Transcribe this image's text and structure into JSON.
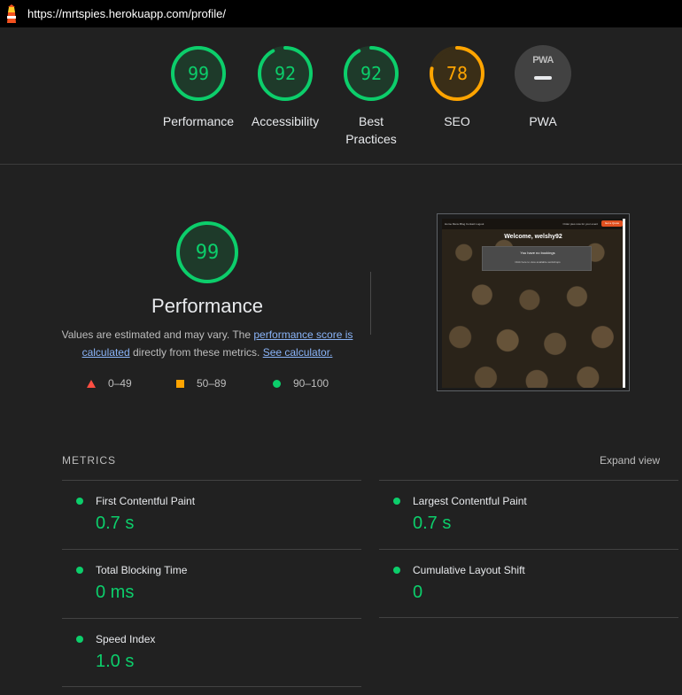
{
  "topbar": {
    "url": "https://mrtspies.herokuapp.com/profile/",
    "logo_icon": "lighthouse-icon"
  },
  "colors": {
    "pass": "#0cce6b",
    "average": "#ffa400",
    "fail": "#ff4e42"
  },
  "gauges": [
    {
      "label": "Performance",
      "score": "99",
      "status": "pass"
    },
    {
      "label": "Accessibility",
      "score": "92",
      "status": "pass"
    },
    {
      "label_line1": "Best",
      "label_line2": "Practices",
      "score": "92",
      "status": "pass"
    },
    {
      "label": "SEO",
      "score": "78",
      "status": "average"
    },
    {
      "label": "PWA",
      "badge_text": "PWA",
      "status": "not-applicable"
    }
  ],
  "performance": {
    "score": "99",
    "title": "Performance",
    "desc_prefix": "Values are estimated and may vary. The ",
    "desc_link1": "performance score is calculated",
    "desc_middle": " directly from these metrics. ",
    "desc_link2": "See calculator.",
    "legend": [
      {
        "range": "0–49",
        "shape": "triangle"
      },
      {
        "range": "50–89",
        "shape": "square"
      },
      {
        "range": "90–100",
        "shape": "circle"
      }
    ]
  },
  "thumbnail": {
    "nav_links": "Home  Menu  Blog  Contact  Logout",
    "nav_right": "Order pies now for your event",
    "nav_button": "Get a Quote",
    "welcome": "Welcome, welshy92",
    "box_title": "You have no bookings",
    "box_sub": "Click here to view available workshops"
  },
  "metrics": {
    "title": "METRICS",
    "expand_label": "Expand view",
    "items": [
      {
        "label": "First Contentful Paint",
        "value": "0.7 s"
      },
      {
        "label": "Largest Contentful Paint",
        "value": "0.7 s"
      },
      {
        "label": "Total Blocking Time",
        "value": "0 ms"
      },
      {
        "label": "Cumulative Layout Shift",
        "value": "0"
      },
      {
        "label": "Speed Index",
        "value": "1.0 s"
      }
    ]
  }
}
